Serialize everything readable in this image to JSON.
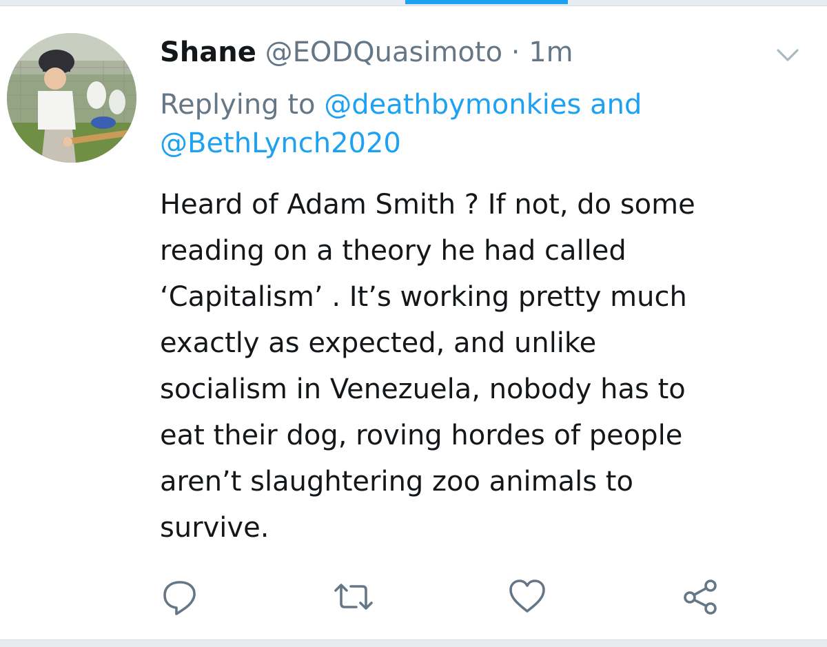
{
  "tweet": {
    "display_name": "Shane",
    "handle": "@EODQuasimoto",
    "separator": "·",
    "time": "1m",
    "reply_context": {
      "prefix": "Replying to",
      "mention_1": "@deathbymonkies",
      "connector": "and",
      "mention_2": "@BethLynch2020"
    },
    "text_lines": [
      "Heard of Adam Smith ? If not, do some",
      "reading on a theory he had called",
      "‘Capitalism’ . It’s working pretty much",
      "exactly as expected, and unlike",
      "socialism in Venezuela, nobody has to",
      "eat their dog, roving hordes of people",
      "aren’t slaughtering zoo animals to",
      "survive."
    ]
  },
  "icons": {
    "caret": "chevron-down-icon",
    "reply": "reply-bubble-icon",
    "retweet": "retweet-arrows-icon",
    "like": "heart-icon",
    "share": "share-nodes-icon"
  },
  "colors": {
    "accent": "#1da1f2",
    "secondary_text": "#657786",
    "primary_text": "#14171a",
    "divider": "#e6ecf0"
  }
}
